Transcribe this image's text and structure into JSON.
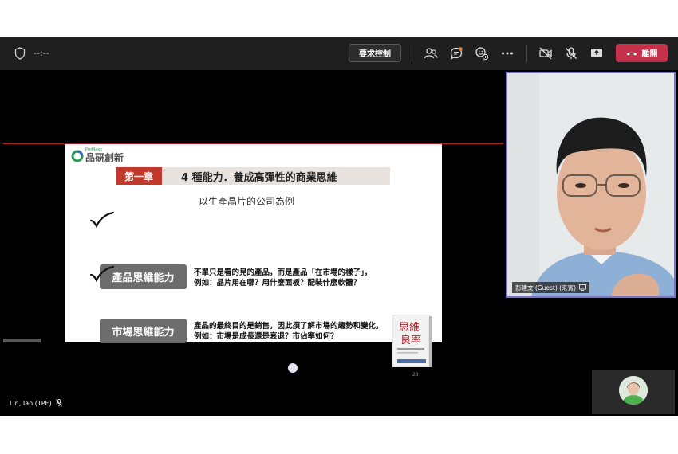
{
  "topbar": {
    "timer": "--:--",
    "request_control": "要求控制",
    "leave_label": "離開"
  },
  "icons": {
    "shield": "shield-icon",
    "people": "people-icon",
    "chat": "chat-icon",
    "reactions": "reactions-icon",
    "more": "more-icon",
    "camera_off": "camera-off-icon",
    "mic_off": "mic-off-icon",
    "share": "share-icon",
    "hangup": "phone-hangup-icon"
  },
  "slide": {
    "logo_text": "品硏創新",
    "logo_small": "ProMaxx",
    "chapter": "第一章",
    "title": "4 種能力．養成高彈性的商業思維",
    "subtitle": "以生產晶片的公司為例",
    "items": [
      {
        "label": "產品思維能力",
        "line1": "不單只是看的見的產品，而是產品「在市場的樣子」，",
        "line2": "例如：晶片用在哪？用什麼面板？配裝什麼軟體？"
      },
      {
        "label": "市場思維能力",
        "line1": "產品的最終目的是銷售，因此須了解市場的趨勢和變化，",
        "line2": "例如：市場是成長還是衰退？市佔率如何？"
      }
    ],
    "book_title_1": "思維",
    "book_title_2": "良率",
    "page_number": "23"
  },
  "participant": {
    "name": "彭建文 (Guest) (來賓)"
  },
  "self": {
    "name": "Lin, Ian (TPE)"
  },
  "colors": {
    "accent": "#7a74c8",
    "leave": "#c4314b",
    "chapter": "#c0392b",
    "pill": "#6d6d6d"
  }
}
